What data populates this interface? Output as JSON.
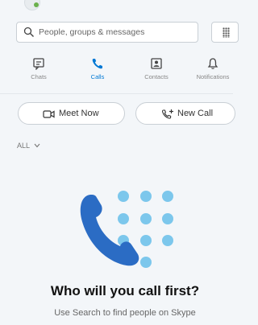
{
  "search": {
    "placeholder": "People, groups & messages"
  },
  "nav": {
    "items": [
      {
        "label": "Chats",
        "icon": "chat-icon",
        "active": false
      },
      {
        "label": "Calls",
        "icon": "phone-icon",
        "active": true
      },
      {
        "label": "Contacts",
        "icon": "contacts-icon",
        "active": false
      },
      {
        "label": "Notifications",
        "icon": "bell-icon",
        "active": false
      }
    ]
  },
  "actions": {
    "meet_now": {
      "label": "Meet Now",
      "icon": "video-camera-icon"
    },
    "new_call": {
      "label": "New Call",
      "icon": "phone-plus-icon"
    }
  },
  "filter": {
    "label": "ALL",
    "icon": "chevron-down-icon"
  },
  "empty_state": {
    "title": "Who will you call first?",
    "subtitle": "Use Search to find people on Skype",
    "illustration": "phone-dialpad-illustration"
  },
  "colors": {
    "accent": "#0078d4",
    "phone_blue": "#2b6cc4",
    "dot_blue": "#7cc7ec",
    "background": "#f3f6f9"
  }
}
